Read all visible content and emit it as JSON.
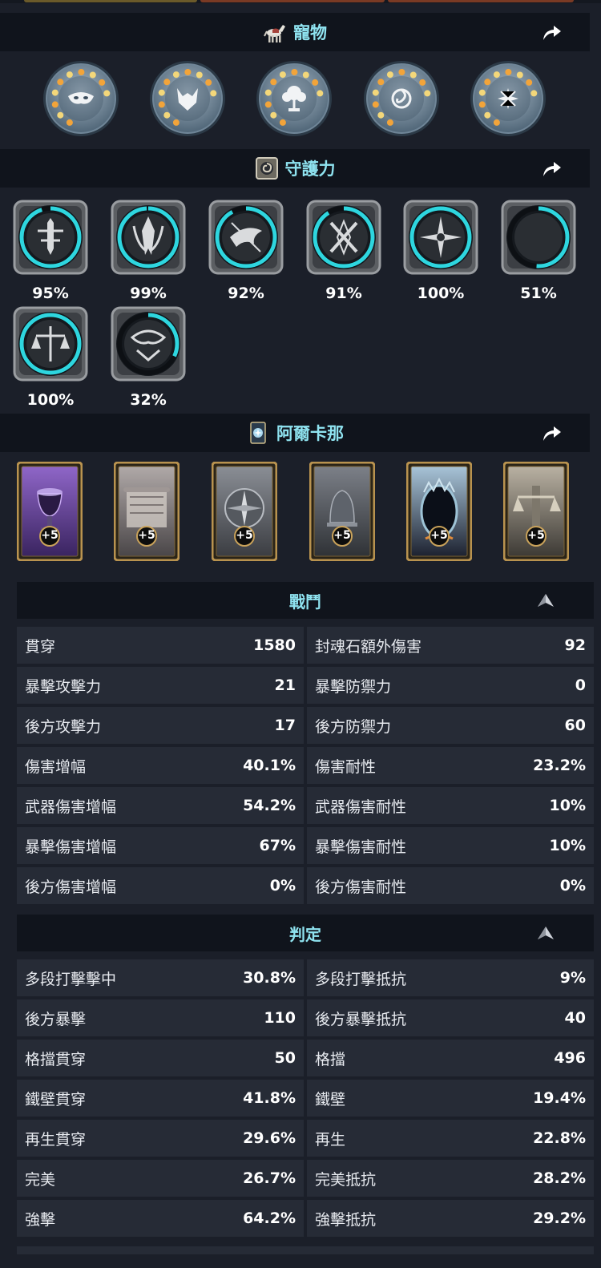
{
  "pets": {
    "title": "寵物",
    "header_icon": "horse-icon",
    "share_icon": "share-arrow-icon",
    "items": [
      {
        "icon": "mask-icon"
      },
      {
        "icon": "fox-icon"
      },
      {
        "icon": "tree-icon"
      },
      {
        "icon": "spiral-icon"
      },
      {
        "icon": "flower-icon"
      }
    ]
  },
  "guardian": {
    "title": "守護力",
    "header_icon": "swirl-emblem-icon",
    "share_icon": "share-arrow-icon",
    "items": [
      {
        "icon": "sword-emblem-icon",
        "percent_label": "95%",
        "progress": 0.95
      },
      {
        "icon": "blades-emblem-icon",
        "percent_label": "99%",
        "progress": 0.99
      },
      {
        "icon": "bird-emblem-icon",
        "percent_label": "92%",
        "progress": 0.92
      },
      {
        "icon": "crossed-swords-emblem-icon",
        "percent_label": "91%",
        "progress": 0.91
      },
      {
        "icon": "star-emblem-icon",
        "percent_label": "100%",
        "progress": 1.0
      },
      {
        "icon": "moon-emblem-icon",
        "percent_label": "51%",
        "progress": 0.51
      },
      {
        "icon": "scales-emblem-icon",
        "percent_label": "100%",
        "progress": 1.0
      },
      {
        "icon": "thorn-crown-emblem-icon",
        "percent_label": "32%",
        "progress": 0.32
      }
    ]
  },
  "arcana": {
    "title": "阿爾卡那",
    "header_icon": "card-emblem-icon",
    "share_icon": "share-arrow-icon",
    "cards": [
      {
        "icon": "chalice-card-icon",
        "badge": "+5"
      },
      {
        "icon": "scroll-card-icon",
        "badge": "+5"
      },
      {
        "icon": "compass-card-icon",
        "badge": "+5"
      },
      {
        "icon": "bell-card-icon",
        "badge": "+5"
      },
      {
        "icon": "mirror-card-icon",
        "badge": "+5"
      },
      {
        "icon": "justice-card-icon",
        "badge": "+5"
      }
    ]
  },
  "combat": {
    "title": "戰鬥",
    "toggle_icon": "collapse-arrow-icon",
    "rows": [
      [
        {
          "label": "貫穿",
          "value": "1580"
        },
        {
          "label": "封魂石額外傷害",
          "value": "92"
        }
      ],
      [
        {
          "label": "暴擊攻擊力",
          "value": "21"
        },
        {
          "label": "暴擊防禦力",
          "value": "0"
        }
      ],
      [
        {
          "label": "後方攻擊力",
          "value": "17"
        },
        {
          "label": "後方防禦力",
          "value": "60"
        }
      ],
      [
        {
          "label": "傷害增幅",
          "value": "40.1%"
        },
        {
          "label": "傷害耐性",
          "value": "23.2%"
        }
      ],
      [
        {
          "label": "武器傷害增幅",
          "value": "54.2%"
        },
        {
          "label": "武器傷害耐性",
          "value": "10%"
        }
      ],
      [
        {
          "label": "暴擊傷害增幅",
          "value": "67%"
        },
        {
          "label": "暴擊傷害耐性",
          "value": "10%"
        }
      ],
      [
        {
          "label": "後方傷害增幅",
          "value": "0%"
        },
        {
          "label": "後方傷害耐性",
          "value": "0%"
        }
      ]
    ]
  },
  "judgement": {
    "title": "判定",
    "toggle_icon": "collapse-arrow-icon",
    "rows": [
      [
        {
          "label": "多段打擊擊中",
          "value": "30.8%"
        },
        {
          "label": "多段打擊抵抗",
          "value": "9%"
        }
      ],
      [
        {
          "label": "後方暴擊",
          "value": "110"
        },
        {
          "label": "後方暴擊抵抗",
          "value": "40"
        }
      ],
      [
        {
          "label": "格擋貫穿",
          "value": "50"
        },
        {
          "label": "格擋",
          "value": "496"
        }
      ],
      [
        {
          "label": "鐵壁貫穿",
          "value": "41.8%"
        },
        {
          "label": "鐵壁",
          "value": "19.4%"
        }
      ],
      [
        {
          "label": "再生貫穿",
          "value": "29.6%"
        },
        {
          "label": "再生",
          "value": "22.8%"
        }
      ],
      [
        {
          "label": "完美",
          "value": "26.7%"
        },
        {
          "label": "完美抵抗",
          "value": "28.2%"
        }
      ],
      [
        {
          "label": "強擊",
          "value": "64.2%"
        },
        {
          "label": "強擊抵抗",
          "value": "29.2%"
        }
      ]
    ]
  },
  "colors": {
    "accent_cyan": "#8fe3f0",
    "ring_cyan": "#2ed6df",
    "background": "#1b1f29",
    "header_bg": "#10141c",
    "cell_bg": "#262b36",
    "gold_frame": "#b9934f"
  }
}
